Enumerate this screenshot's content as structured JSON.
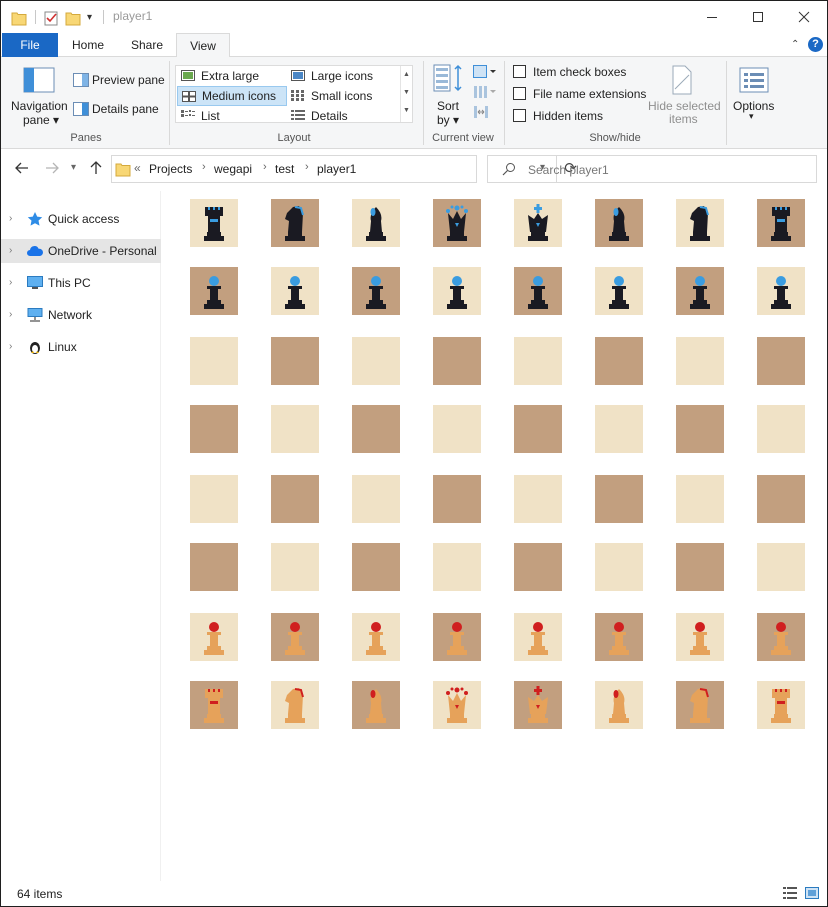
{
  "window": {
    "title": "player1"
  },
  "ribbon_tabs": {
    "file": "File",
    "home": "Home",
    "share": "Share",
    "view": "View"
  },
  "panes": {
    "navigation_pane_line1": "Navigation",
    "navigation_pane_line2": "pane",
    "preview_pane": "Preview pane",
    "details_pane": "Details pane",
    "group_label": "Panes"
  },
  "layout": {
    "items": [
      "Extra large icons",
      "Large icons",
      "Medium icons",
      "Small icons",
      "List",
      "Details"
    ],
    "selected": "Medium icons",
    "group_label": "Layout"
  },
  "current_view": {
    "sort_line1": "Sort",
    "sort_line2": "by",
    "group_label": "Current view"
  },
  "show_hide": {
    "item_check_boxes": "Item check boxes",
    "file_name_extensions": "File name extensions",
    "hidden_items": "Hidden items",
    "hide_selected_line1": "Hide selected",
    "hide_selected_line2": "items",
    "group_label": "Show/hide"
  },
  "options": {
    "label": "Options"
  },
  "address": {
    "overflow": "«",
    "crumbs": [
      "Projects",
      "wegapi",
      "test",
      "player1"
    ]
  },
  "search": {
    "placeholder": "Search player1"
  },
  "nav_pane": {
    "items": [
      "Quick access",
      "OneDrive - Personal",
      "This PC",
      "Network",
      "Linux"
    ],
    "selected": "OneDrive - Personal"
  },
  "colors": {
    "light_square": "#f0e2c6",
    "dark_square": "#c29f7f",
    "black_piece": "#1a1a22",
    "black_accent": "#3a9ce0",
    "white_piece": "#e6a25a",
    "white_accent": "#d01f1f",
    "accent_blue": "#1a68c5"
  },
  "grid": {
    "rows": [
      [
        "rook-black",
        "knight-black",
        "bishop-black",
        "queen-black",
        "king-black",
        "bishop-black",
        "knight-black",
        "rook-black"
      ],
      [
        "pawn-black",
        "pawn-black",
        "pawn-black",
        "pawn-black",
        "pawn-black",
        "pawn-black",
        "pawn-black",
        "pawn-black"
      ],
      [
        "empty",
        "empty",
        "empty",
        "empty",
        "empty",
        "empty",
        "empty",
        "empty"
      ],
      [
        "empty",
        "empty",
        "empty",
        "empty",
        "empty",
        "empty",
        "empty",
        "empty"
      ],
      [
        "empty",
        "empty",
        "empty",
        "empty",
        "empty",
        "empty",
        "empty",
        "empty"
      ],
      [
        "empty",
        "empty",
        "empty",
        "empty",
        "empty",
        "empty",
        "empty",
        "empty"
      ],
      [
        "pawn-white",
        "pawn-white",
        "pawn-white",
        "pawn-white",
        "pawn-white",
        "pawn-white",
        "pawn-white",
        "pawn-white"
      ],
      [
        "rook-white",
        "knight-white",
        "bishop-white",
        "queen-white",
        "king-white",
        "bishop-white",
        "knight-white",
        "rook-white"
      ]
    ]
  },
  "status": {
    "item_count": "64 items"
  }
}
